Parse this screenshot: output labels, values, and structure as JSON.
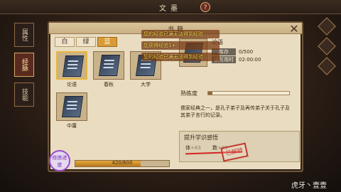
{
  "header": {
    "title": "文墨",
    "help": "?"
  },
  "left_nav": [
    {
      "label": "属性",
      "active": false
    },
    {
      "label": "经脉",
      "active": true
    },
    {
      "label": "技能",
      "active": false
    }
  ],
  "panel": {
    "title": "书籍",
    "close": "✕",
    "tabs": [
      "白",
      "绿",
      "蓝"
    ],
    "active_tab": "蓝"
  },
  "books": [
    {
      "name": "论语",
      "selected": true
    },
    {
      "name": "春秋",
      "selected": false
    },
    {
      "name": "大学",
      "selected": false
    },
    {
      "name": "中庸",
      "selected": false
    }
  ],
  "messages": [
    "您的经验已满无法得到经验",
    "您获得经验1+",
    "您的经验已满无法得到经验"
  ],
  "info": {
    "book_name": "论语",
    "stock_label": "库存",
    "stock_value": "0/500",
    "read_label": "读写用时",
    "read_value": "02:00:00",
    "proficiency_label": "熟练度",
    "proficiency_value": 0.05,
    "description": "儒家经典之一，是孔子弟子及再传弟子关于孔子及其弟子言行的记录。",
    "gain_title": "提升学识感悟",
    "gain_items": [
      {
        "label": "体",
        "value": "+83"
      },
      {
        "label": "数",
        "value": "+83"
      }
    ],
    "stamp": "已解锁"
  },
  "bottom": {
    "progress_text": "420/600",
    "progress_value": 0.7,
    "tag": "修炼进度"
  },
  "watermark": "虎牙丶壹壹"
}
